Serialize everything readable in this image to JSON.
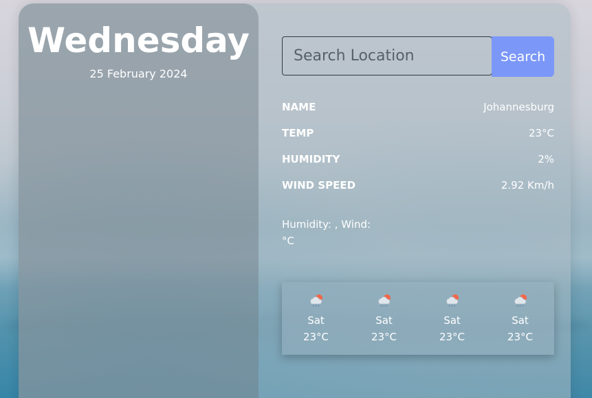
{
  "left": {
    "day": "Wednesday",
    "date": "25 February 2024"
  },
  "search": {
    "placeholder": "Search Location",
    "button_label": "Search"
  },
  "details": [
    {
      "label": "NAME",
      "value": "Johannesburg"
    },
    {
      "label": "TEMP",
      "value": "23°C"
    },
    {
      "label": "HUMIDITY",
      "value": "2%"
    },
    {
      "label": "WIND SPEED",
      "value": "2.92 Km/h"
    }
  ],
  "summary": {
    "line1": "Humidity: , Wind:",
    "line2": "°C"
  },
  "forecast": [
    {
      "icon": "rain-cloud-sun-icon",
      "day": "Sat",
      "temp": "23°C"
    },
    {
      "icon": "rain-cloud-sun-icon",
      "day": "Sat",
      "temp": "23°C"
    },
    {
      "icon": "rain-cloud-sun-icon",
      "day": "Sat",
      "temp": "23°C"
    },
    {
      "icon": "rain-cloud-sun-icon",
      "day": "Sat",
      "temp": "23°C"
    }
  ],
  "colors": {
    "accent": "#7b97f8",
    "text": "#ffffff"
  }
}
